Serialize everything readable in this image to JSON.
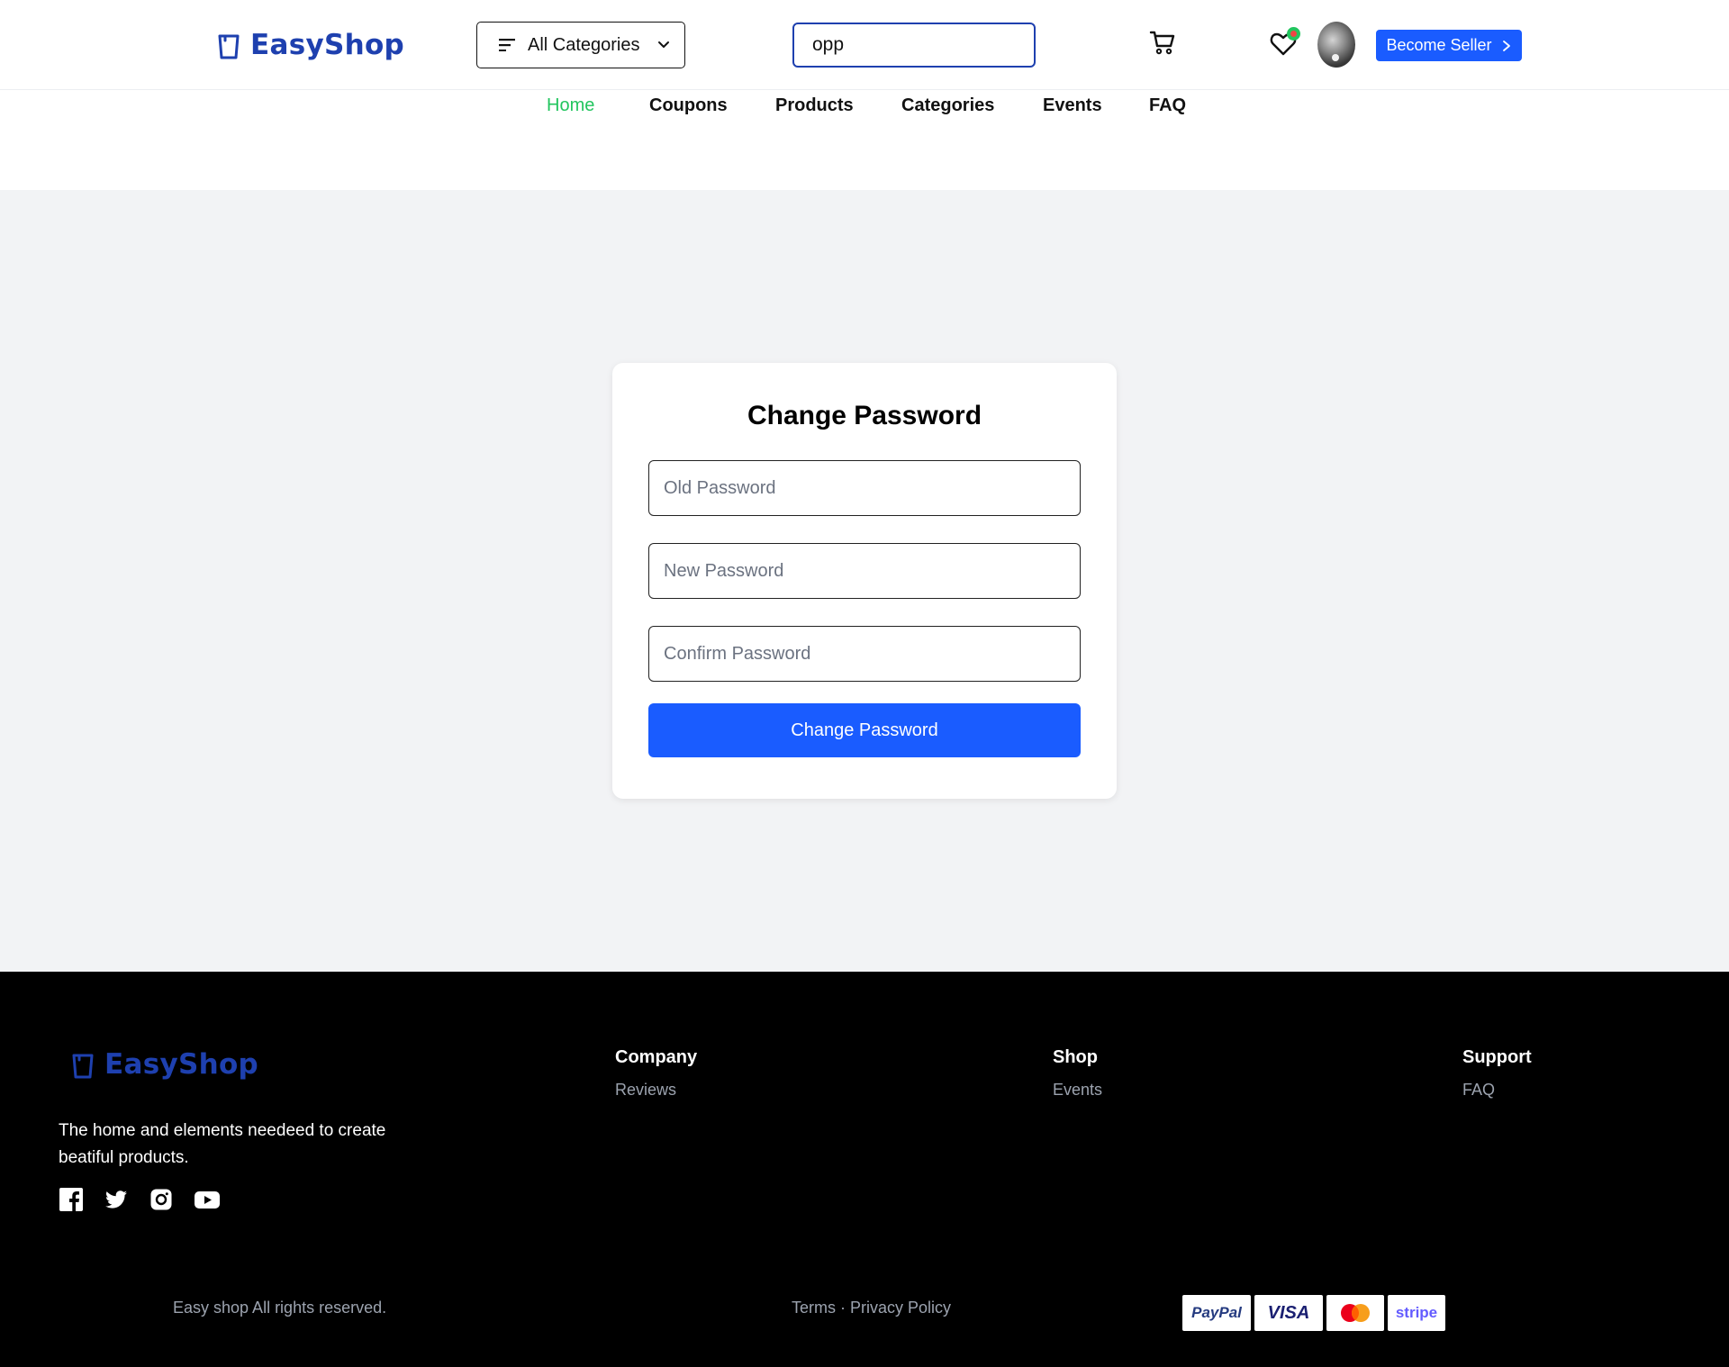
{
  "brand": {
    "name": "EasyShop",
    "color": "#1e40af",
    "icon": "shopping-bag-icon"
  },
  "header": {
    "categories_label": "All Categories",
    "search_value": "opp",
    "cart_icon": "cart-icon",
    "wishlist_icon": "heart-icon",
    "seller_label": "Become Seller"
  },
  "nav": {
    "items": [
      {
        "label": "Home",
        "active": true
      },
      {
        "label": "Coupons"
      },
      {
        "label": "Products"
      },
      {
        "label": "Categories"
      },
      {
        "label": "Events"
      },
      {
        "label": "FAQ"
      }
    ],
    "active_color": "#22c55e"
  },
  "form": {
    "title": "Change Password",
    "old_placeholder": "Old Password",
    "new_placeholder": "New Password",
    "confirm_placeholder": "Confirm Password",
    "submit_label": "Change Password",
    "accent": "#1a5cff"
  },
  "footer": {
    "brand": "EasyShop",
    "description": "The home and elements needeed to create beatiful products.",
    "socials": [
      "facebook-icon",
      "twitter-icon",
      "instagram-icon",
      "youtube-icon"
    ],
    "columns": [
      {
        "title": "Company",
        "links": [
          "Reviews"
        ]
      },
      {
        "title": "Shop",
        "links": [
          "Events"
        ]
      },
      {
        "title": "Support",
        "links": [
          "FAQ"
        ]
      }
    ],
    "copyright": "Easy shop All rights reserved.",
    "terms": "Terms",
    "separator": "·",
    "privacy": "Privacy Policy",
    "payments": [
      "PayPal",
      "VISA",
      "Mastercard",
      "stripe"
    ]
  }
}
